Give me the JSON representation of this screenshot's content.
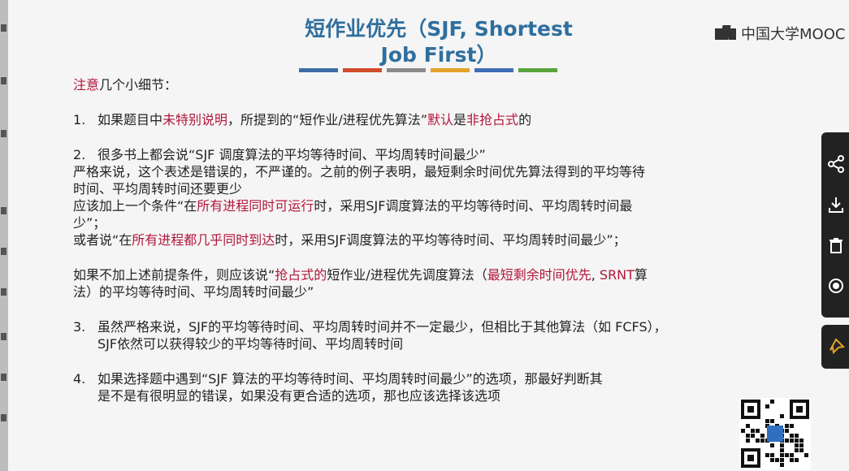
{
  "slide": {
    "title_line1": "短作业优先（SJF, Shortest",
    "title_line2": "Job First）",
    "title_bar_colors": [
      "#3b6fa5",
      "#d24b2b",
      "#8a8a8a",
      "#e3a32a",
      "#3f6fb5",
      "#5aa43c"
    ],
    "logo_text": "中国大学MOOC",
    "note_red": "注意",
    "note_rest": "几个小细节：",
    "item1": {
      "num": "1.",
      "t1": "如果题目中",
      "r1": "未特别说明",
      "t2": "，所提到的“短作业/进程优先算法”",
      "r2": "默认",
      "t3": "是",
      "r3": "非抢占式",
      "t4": "的"
    },
    "item2": {
      "num": "2.",
      "line1": "很多书上都会说“SJF 调度算法的平均等待时间、平均周转时间最少”",
      "line2": "严格来说，这个表述是错误的，不严谨的。之前的例子表明，最短剩余时间优先算法得到的平均等待",
      "line3": "时间、平均周转时间还要更少",
      "cond_t1": "应该加上一个条件“在",
      "cond_r1": "所有进程同时可运行",
      "cond_t2": "时，采用SJF调度算法的平均等待时间、平均周转时间最",
      "cond_line2": "少”；",
      "or_t1": "或者说“在",
      "or_r1": "所有进程都几乎同时到达",
      "or_t2": "时，采用SJF调度算法的平均等待时间、平均周转时间最少”；",
      "if_t1": "如果不加上述前提条件，则应该说“",
      "if_r1": "抢占式的",
      "if_t2": "短作业/进程优先调度算法（",
      "if_r2": "最短剩余时间优先",
      "if_t3": ", ",
      "if_r3": "SRNT",
      "if_t4": "算",
      "if_line2": "法）的平均等待时间、平均周转时间最少”"
    },
    "item3": {
      "num": "3.",
      "line1": "虽然严格来说，SJF的平均等待时间、平均周转时间并不一定最少，但相比于其他算法（如 FCFS），",
      "line2": "SJF依然可以获得较少的平均等待时间、平均周转时间"
    },
    "item4": {
      "num": "4.",
      "line1": "如果选择题中遇到“SJF 算法的平均等待时间、平均周转时间最少”的选项，那最好判断其",
      "line2": "是不是有很明显的错误，如果没有更合适的选项，那也应该选择该选项"
    }
  },
  "side_panel": {
    "icons": [
      "share-icon",
      "download-icon",
      "delete-icon",
      "record-icon",
      "pin-icon"
    ]
  }
}
